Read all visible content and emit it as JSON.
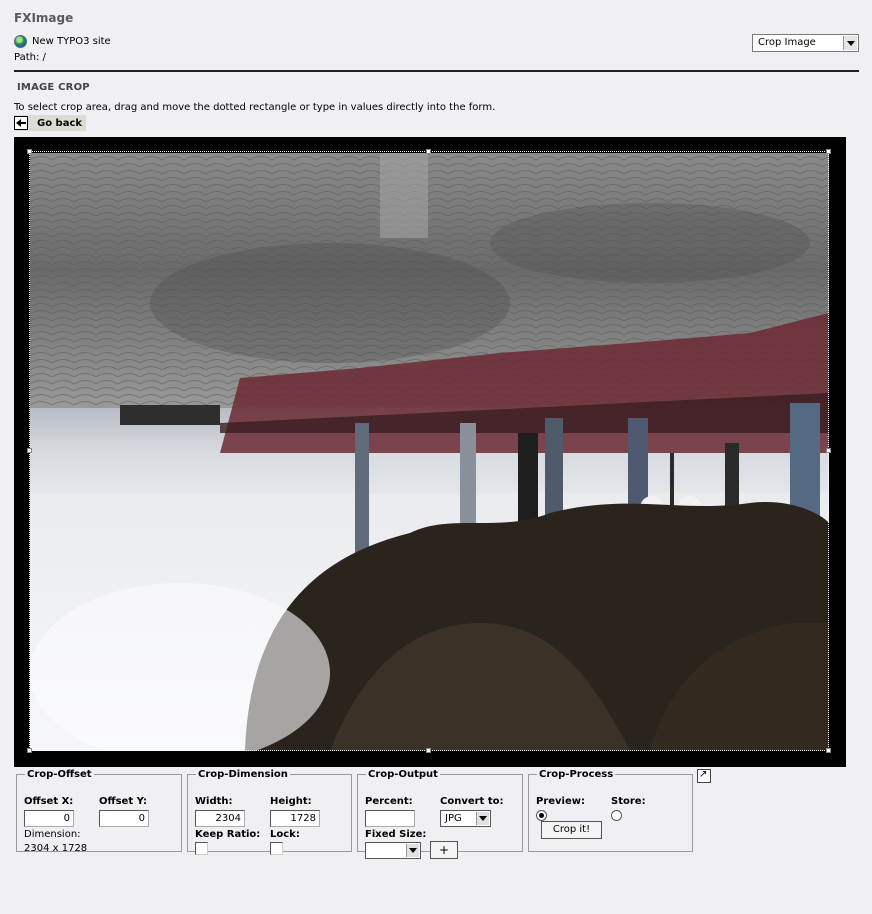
{
  "app": {
    "title": "FXImage"
  },
  "site": {
    "name": "New TYPO3 site",
    "path": "Path: /"
  },
  "action_select": {
    "value": "Crop Image"
  },
  "section": {
    "title": "IMAGE CROP",
    "instructions": "To select crop area, drag and move the dotted rectangle or type in values directly into the form.",
    "go_back": "Go back"
  },
  "crop_offset": {
    "legend": "Crop-Offset",
    "offset_x_label": "Offset X:",
    "offset_x": "0",
    "offset_y_label": "Offset Y:",
    "offset_y": "0",
    "dimension_label": "Dimension:",
    "dimension": "2304 x 1728"
  },
  "crop_dimension": {
    "legend": "Crop-Dimension",
    "width_label": "Width:",
    "width": "2304",
    "height_label": "Height:",
    "height": "1728",
    "keep_ratio_label": "Keep Ratio:",
    "lock_label": "Lock:"
  },
  "crop_output": {
    "legend": "Crop-Output",
    "percent_label": "Percent:",
    "percent": "",
    "convert_label": "Convert to:",
    "convert": "JPG",
    "fixed_size_label": "Fixed Size:",
    "fixed_size": "",
    "add_label": "+"
  },
  "crop_process": {
    "legend": "Crop-Process",
    "preview_label": "Preview:",
    "store_label": "Store:",
    "crop_button": "Crop it!",
    "selected": "Preview"
  },
  "icons": [
    "globe-icon",
    "back-arrow-icon",
    "dropdown-arrow-icon",
    "popup-icon"
  ]
}
